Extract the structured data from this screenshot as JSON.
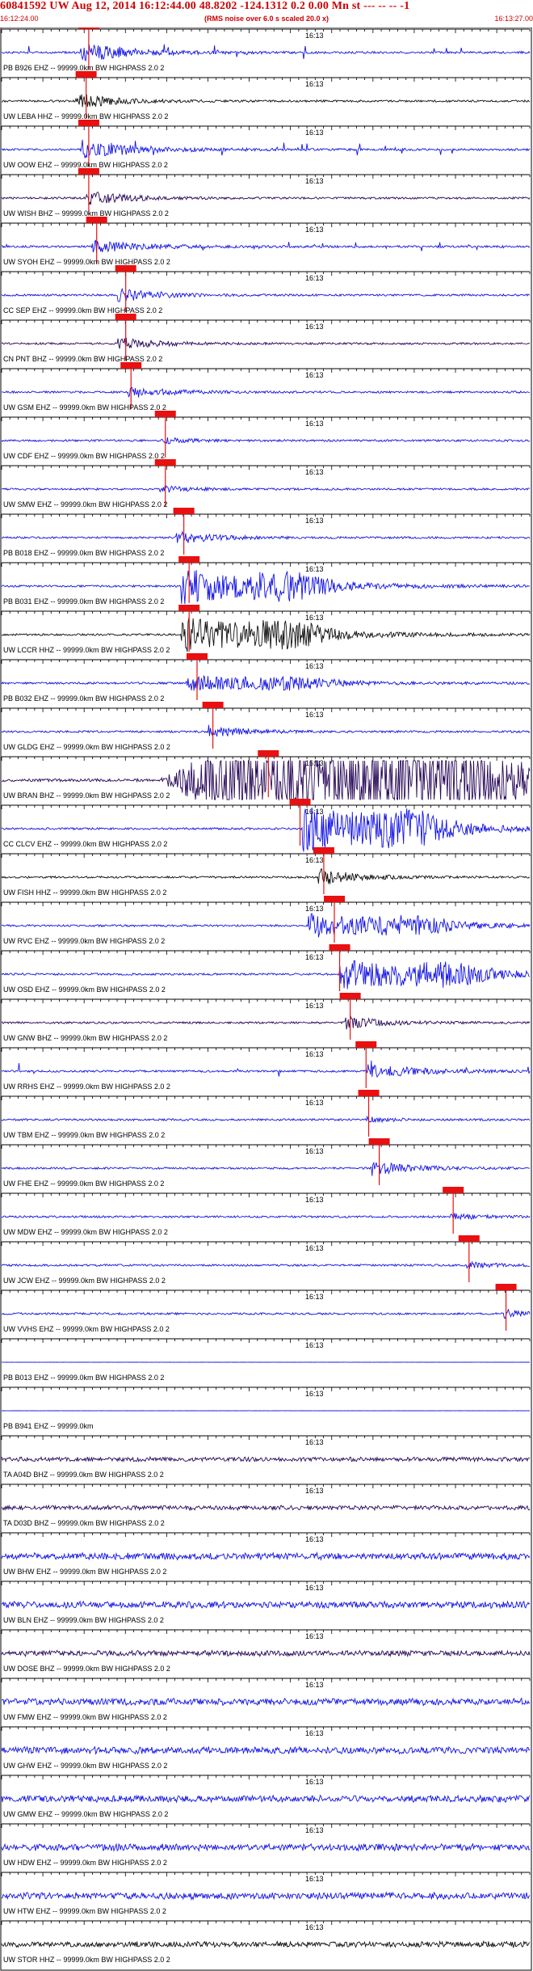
{
  "header": {
    "title": "60841592 UW Aug 12, 2014 16:12:44.00   48.8202 -124.1312  0.2 0.00 Mn st --- -- --   -1",
    "start_time": "16:12:24.00",
    "rms_note": "(RMS noise over 6.0 s scaled 20.0 x)",
    "end_time": "16:13:27.00"
  },
  "colors": {
    "trace_blue": "#1414e6",
    "trace_black": "#111111",
    "trace_purple": "#2a0a5a",
    "pick_red": "#e81010",
    "header_red": "#cc0000"
  },
  "minute_label": "16:13",
  "traces": [
    {
      "label": "PB B926 EHZ -- 99999.0km BW  HIGHPASS  2.0  2",
      "color": "blue",
      "amp": 0.45,
      "pick": 0.165,
      "onset": 0.15,
      "char": "spiky"
    },
    {
      "label": "UW LEBA HHZ -- 99999.0km BW  HIGHPASS  2.0  2",
      "color": "black",
      "amp": 0.4,
      "pick": 0.16,
      "onset": 0.14,
      "char": "burst"
    },
    {
      "label": "UW OOW EHZ -- 99999.0km BW  HIGHPASS  2.0  2",
      "color": "blue",
      "amp": 0.5,
      "pick": 0.165,
      "onset": 0.15,
      "char": "spiky"
    },
    {
      "label": "UW WISH BHZ -- 99999.0km BW  HIGHPASS  2.0  2",
      "color": "purple",
      "amp": 0.35,
      "pick": 0.165,
      "onset": 0.16,
      "char": "burst"
    },
    {
      "label": "UW SYOH EHZ -- 99999.0km BW  HIGHPASS  2.0  2",
      "color": "blue",
      "amp": 0.3,
      "pick": 0.18,
      "onset": 0.17,
      "char": "spiky"
    },
    {
      "label": "CC SEP EHZ -- 99999.0km BW  HIGHPASS  2.0  2",
      "color": "blue",
      "amp": 0.35,
      "pick": 0.235,
      "onset": 0.22,
      "char": "burst"
    },
    {
      "label": "CN PNT BHZ -- 99999.0km BW  HIGHPASS  2.0  2",
      "color": "purple",
      "amp": 0.3,
      "pick": 0.235,
      "onset": 0.22,
      "char": "burst"
    },
    {
      "label": "UW GSM EHZ -- 99999.0km BW  HIGHPASS  2.0  2",
      "color": "blue",
      "amp": 0.3,
      "pick": 0.245,
      "onset": 0.24,
      "char": "burst"
    },
    {
      "label": "UW CDF EHZ -- 99999.0km BW  HIGHPASS  2.0  2",
      "color": "blue",
      "amp": 0.2,
      "pick": 0.31,
      "onset": 0.3,
      "char": "small"
    },
    {
      "label": "UW SMW EHZ -- 99999.0km BW  HIGHPASS  2.0  2",
      "color": "blue",
      "amp": 0.2,
      "pick": 0.31,
      "onset": 0.3,
      "char": "small"
    },
    {
      "label": "PB B018 EHZ -- 99999.0km BW  HIGHPASS  2.0  2",
      "color": "blue",
      "amp": 0.3,
      "pick": 0.345,
      "onset": 0.33,
      "char": "burst"
    },
    {
      "label": "PB B031 EHZ -- 99999.0km BW  HIGHPASS  2.0  2",
      "color": "blue",
      "amp": 0.9,
      "pick": 0.355,
      "onset": 0.34,
      "char": "big"
    },
    {
      "label": "UW LCCR HHZ -- 99999.0km BW  HIGHPASS  2.0  2",
      "color": "black",
      "amp": 0.9,
      "pick": 0.355,
      "onset": 0.34,
      "char": "big"
    },
    {
      "label": "PB B032 EHZ -- 99999.0km BW  HIGHPASS  2.0  2",
      "color": "blue",
      "amp": 0.4,
      "pick": 0.37,
      "onset": 0.35,
      "char": "big"
    },
    {
      "label": "UW GLDG EHZ -- 99999.0km BW  HIGHPASS  2.0  2",
      "color": "blue",
      "amp": 0.3,
      "pick": 0.4,
      "onset": 0.39,
      "char": "burst"
    },
    {
      "label": "UW BRAN BHZ -- 99999.0km BW  HIGHPASS  2.0  2",
      "color": "purple",
      "amp": 1.4,
      "pick": 0.505,
      "onset": 0.3,
      "char": "clip"
    },
    {
      "label": "CC CLCV EHZ -- 99999.0km BW  HIGHPASS  2.0  2",
      "color": "blue",
      "amp": 1.2,
      "pick": 0.565,
      "onset": 0.57,
      "char": "big"
    },
    {
      "label": "UW FISH HHZ -- 99999.0km BW  HIGHPASS  2.0  2",
      "color": "black",
      "amp": 0.4,
      "pick": 0.61,
      "onset": 0.6,
      "char": "burst"
    },
    {
      "label": "UW RVC EHZ -- 99999.0km BW  HIGHPASS  2.0  2",
      "color": "blue",
      "amp": 0.6,
      "pick": 0.63,
      "onset": 0.58,
      "char": "big"
    },
    {
      "label": "UW OSD EHZ -- 99999.0km BW  HIGHPASS  2.0  2",
      "color": "blue",
      "amp": 0.8,
      "pick": 0.64,
      "onset": 0.64,
      "char": "big"
    },
    {
      "label": "UW GNW BHZ -- 99999.0km BW  HIGHPASS  2.0  2",
      "color": "purple",
      "amp": 0.3,
      "pick": 0.66,
      "onset": 0.65,
      "char": "burst"
    },
    {
      "label": "UW RRHS EHZ -- 99999.0km BW  HIGHPASS  2.0  2",
      "color": "blue",
      "amp": 0.35,
      "pick": 0.69,
      "onset": 0.69,
      "char": "spiky"
    },
    {
      "label": "UW TBM EHZ -- 99999.0km BW  HIGHPASS  2.0  2",
      "color": "blue",
      "amp": 0.15,
      "pick": 0.695,
      "onset": 0.69,
      "char": "small"
    },
    {
      "label": "UW FHE EHZ -- 99999.0km BW  HIGHPASS  2.0  2",
      "color": "blue",
      "amp": 0.35,
      "pick": 0.715,
      "onset": 0.7,
      "char": "burst"
    },
    {
      "label": "UW MDW EHZ -- 99999.0km BW  HIGHPASS  2.0  2",
      "color": "blue",
      "amp": 0.2,
      "pick": 0.855,
      "onset": 0.85,
      "char": "small"
    },
    {
      "label": "UW JCW EHZ -- 99999.0km BW  HIGHPASS  2.0  2",
      "color": "blue",
      "amp": 0.2,
      "pick": 0.885,
      "onset": 0.88,
      "char": "small"
    },
    {
      "label": "UW VVHS EHZ -- 99999.0km BW  HIGHPASS  2.0  2",
      "color": "blue",
      "amp": 0.3,
      "pick": 0.955,
      "onset": 0.95,
      "char": "small"
    },
    {
      "label": "PB B013 EHZ -- 99999.0km BW  HIGHPASS  2.0  2",
      "color": "blue",
      "amp": 0.0,
      "pick": null,
      "onset": 1.0,
      "char": "flat"
    },
    {
      "label": "PB B941 EHZ -- 99999.0km",
      "color": "blue",
      "amp": 0.0,
      "pick": null,
      "onset": 1.0,
      "char": "flat"
    },
    {
      "label": "TA A04D BHZ -- 99999.0km BW  HIGHPASS  2.0  2",
      "color": "purple",
      "amp": 0.12,
      "pick": null,
      "onset": 1.0,
      "char": "noise"
    },
    {
      "label": "TA D03D BHZ -- 99999.0km BW  HIGHPASS  2.0  2",
      "color": "purple",
      "amp": 0.12,
      "pick": null,
      "onset": 1.0,
      "char": "noise"
    },
    {
      "label": "UW BHW EHZ -- 99999.0km BW  HIGHPASS  2.0  2",
      "color": "blue",
      "amp": 0.18,
      "pick": null,
      "onset": 1.0,
      "char": "noise"
    },
    {
      "label": "UW BLN EHZ -- 99999.0km BW  HIGHPASS  2.0  2",
      "color": "blue",
      "amp": 0.18,
      "pick": null,
      "onset": 1.0,
      "char": "noise"
    },
    {
      "label": "UW DOSE BHZ -- 99999.0km BW  HIGHPASS  2.0  2",
      "color": "purple",
      "amp": 0.15,
      "pick": null,
      "onset": 1.0,
      "char": "noise"
    },
    {
      "label": "UW FMW EHZ -- 99999.0km BW  HIGHPASS  2.0  2",
      "color": "blue",
      "amp": 0.18,
      "pick": null,
      "onset": 1.0,
      "char": "noise"
    },
    {
      "label": "UW GHW EHZ -- 99999.0km BW  HIGHPASS  2.0  2",
      "color": "blue",
      "amp": 0.18,
      "pick": null,
      "onset": 1.0,
      "char": "noise"
    },
    {
      "label": "UW GMW EHZ -- 99999.0km BW  HIGHPASS  2.0  2",
      "color": "blue",
      "amp": 0.18,
      "pick": null,
      "onset": 1.0,
      "char": "noise"
    },
    {
      "label": "UW HDW EHZ -- 99999.0km BW  HIGHPASS  2.0  2",
      "color": "blue",
      "amp": 0.18,
      "pick": null,
      "onset": 1.0,
      "char": "noise"
    },
    {
      "label": "UW HTW EHZ -- 99999.0km BW  HIGHPASS  2.0  2",
      "color": "blue",
      "amp": 0.18,
      "pick": null,
      "onset": 1.0,
      "char": "noise"
    },
    {
      "label": "UW STOR HHZ -- 99999.0km BW  HIGHPASS  2.0  2",
      "color": "black",
      "amp": 0.15,
      "pick": null,
      "onset": 1.0,
      "char": "noise"
    }
  ]
}
